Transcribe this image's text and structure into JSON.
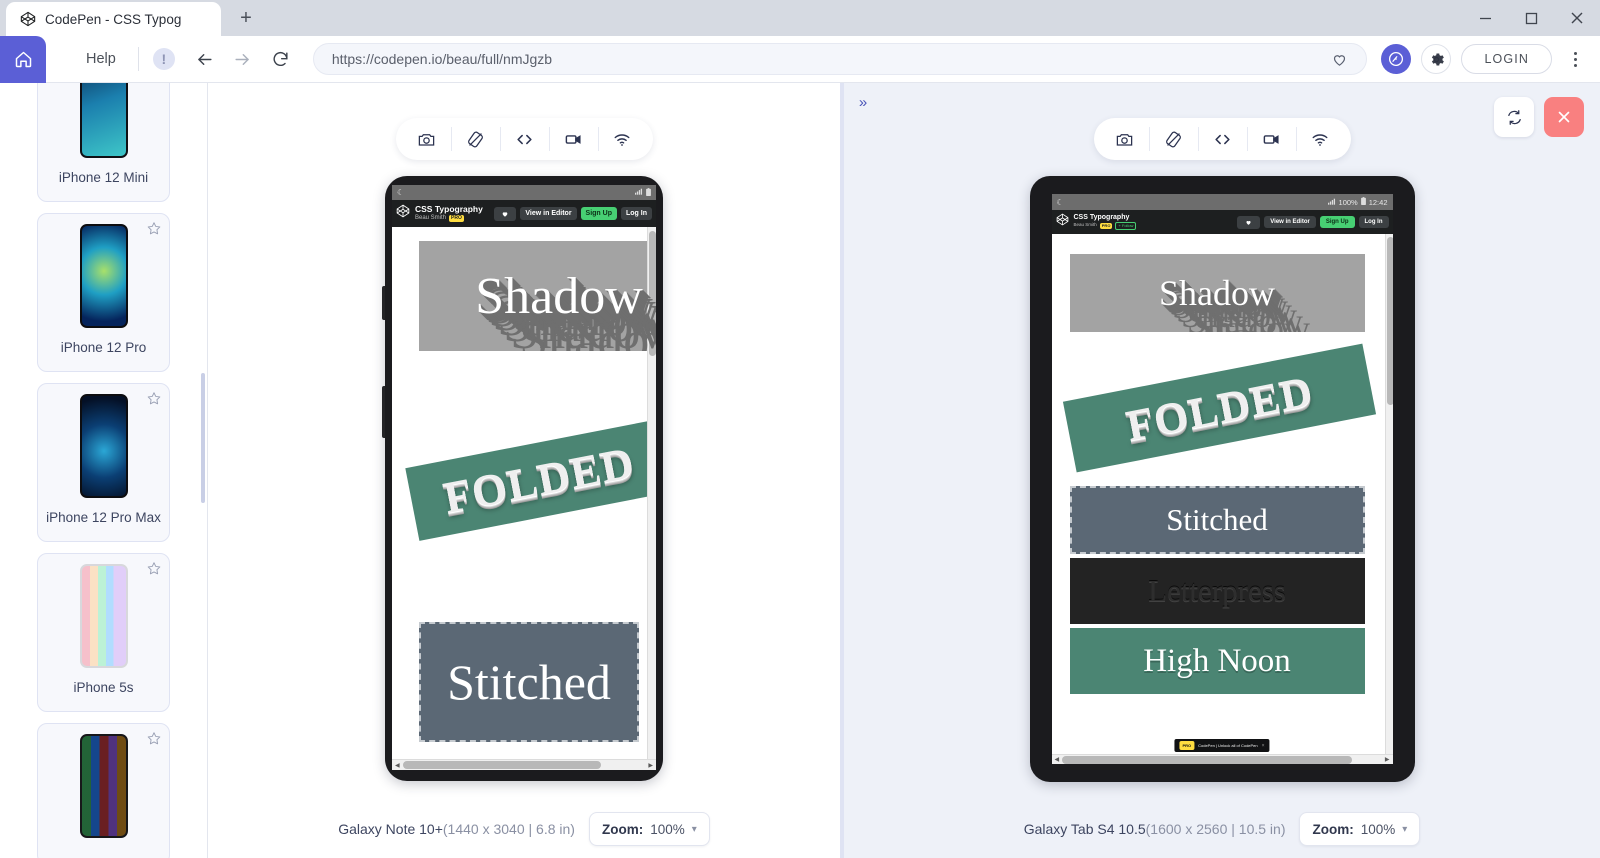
{
  "browser": {
    "tab": {
      "title": "CodePen - CSS Typog",
      "favicon": "codepen-icon"
    },
    "new_tab_label": "+",
    "window_controls": {
      "minimize": "minimize-icon",
      "maximize": "maximize-icon",
      "close": "close-icon"
    },
    "home_label": "home-icon",
    "help_label": "Help",
    "warning_badge": "!",
    "back": "back-arrow-icon",
    "forward": "forward-arrow-icon",
    "reload": "reload-icon",
    "url": "https://codepen.io/beau/full/nmJgzb",
    "bookmark": "heart-icon",
    "gauge": "speedometer-icon",
    "settings": "gear-icon",
    "login_label": "LOGIN",
    "menu": "kebab-menu-icon",
    "accent": "#5b5fd6"
  },
  "sidebar": {
    "devices": [
      {
        "name": "iPhone 12 Mini",
        "thumb": "iphone-12-mini",
        "favorited": false
      },
      {
        "name": "iPhone 12 Pro",
        "thumb": "iphone-12-pro",
        "favorited": false
      },
      {
        "name": "iPhone 12 Pro Max",
        "thumb": "iphone-12-pro-max",
        "favorited": false
      },
      {
        "name": "iPhone 5s",
        "thumb": "iphone-5s",
        "favorited": false
      },
      {
        "name": "",
        "thumb": "iphone-6-plus",
        "favorited": false
      }
    ]
  },
  "panes": {
    "expand_label": "»",
    "toolbar_icons": [
      "camera-icon",
      "rotate-icon",
      "code-icon",
      "video-icon",
      "wifi-icon"
    ],
    "actions": {
      "refresh": "refresh-icon",
      "close": "close-icon"
    },
    "zoom_label": "Zoom:",
    "zoom_caret": "⌄",
    "phone": {
      "device_name": "Galaxy Note 10+",
      "device_dims": "(1440 x 3040 | 6.8 in)",
      "zoom_value": "100%",
      "status": {
        "time": "",
        "battery": "",
        "signal": "signal-icon"
      }
    },
    "tablet": {
      "device_name": "Galaxy Tab S4 10.5",
      "device_dims": "(1600 x 2560 | 10.5 in)",
      "zoom_value": "100%",
      "status": {
        "time": "12:42",
        "battery": "100%",
        "signal": "signal-icon"
      }
    }
  },
  "pen": {
    "title": "CSS Typography",
    "author": "Beau Smith",
    "pro_badge": "PRO",
    "follow_badge": "+ Follow",
    "like_icon": "heart-icon",
    "view_editor_label": "View in Editor",
    "signup_label": "Sign Up",
    "login_label": "Log In",
    "panels": [
      {
        "text": "Shadow",
        "style": "long-shadow",
        "bg": "#a3a3a3"
      },
      {
        "text": "FOLDED",
        "style": "folded",
        "bg": "#4b8573"
      },
      {
        "text": "Stitched",
        "style": "stitched",
        "bg": "#5b6875"
      },
      {
        "text": "Letterpress",
        "style": "letterpress",
        "bg": "#232323"
      },
      {
        "text": "High Noon",
        "style": "high-noon",
        "bg": "#4b8573"
      }
    ],
    "promo": {
      "logo": "PRO",
      "text": "CodePen | Unlock all of CodePen",
      "close": "×"
    }
  }
}
